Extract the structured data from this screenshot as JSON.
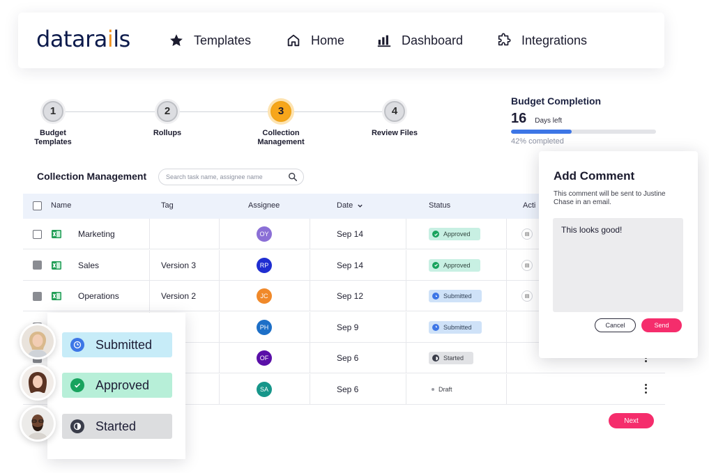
{
  "nav": {
    "logo": {
      "main": "datarails"
    },
    "items": [
      {
        "label": "Templates",
        "icon": "star-icon"
      },
      {
        "label": "Home",
        "icon": "home-icon"
      },
      {
        "label": "Dashboard",
        "icon": "bar-chart-icon"
      },
      {
        "label": "Integrations",
        "icon": "puzzle-icon"
      }
    ]
  },
  "stepper": {
    "steps": [
      {
        "number": "1",
        "label_line1": "Budget",
        "label_line2": "Templates",
        "active": false
      },
      {
        "number": "2",
        "label_line1": "Rollups",
        "label_line2": "",
        "active": false
      },
      {
        "number": "3",
        "label_line1": "Collection",
        "label_line2": "Management",
        "active": true
      },
      {
        "number": "4",
        "label_line1": "Review Files",
        "label_line2": "",
        "active": false
      }
    ]
  },
  "budget": {
    "title": "Budget Completion",
    "days": "16",
    "days_label": "Days left",
    "percent_label": "42% completed",
    "progress": 0.42,
    "progress_color": "#3d76e6"
  },
  "table": {
    "title": "Collection Management",
    "search_placeholder": "Search task name, assignee name",
    "columns": {
      "name": "Name",
      "tag": "Tag",
      "assignee": "Assignee",
      "date": "Date",
      "status": "Status",
      "actions": "Acti"
    },
    "rows": [
      {
        "name": "Marketing",
        "tag": "",
        "assignee": "OY",
        "avatar_color": "#8b6fd6",
        "date": "Sep 14",
        "status": "Approved"
      },
      {
        "name": "Sales",
        "tag": "Version 3",
        "assignee": "RP",
        "avatar_color": "#1f2ed1",
        "date": "Sep 14",
        "status": "Approved"
      },
      {
        "name": "Operations",
        "tag": "Version 2",
        "assignee": "JC",
        "avatar_color": "#f0892a",
        "date": "Sep 12",
        "status": "Submitted"
      },
      {
        "name": "",
        "tag": "n 1",
        "assignee": "PH",
        "avatar_color": "#1d6fc7",
        "date": "Sep 9",
        "status": "Submitted"
      },
      {
        "name": "",
        "tag": "",
        "assignee": "OF",
        "avatar_color": "#5a0fa8",
        "date": "Sep 6",
        "status": "Started"
      },
      {
        "name": "",
        "tag": "",
        "assignee": "SA",
        "avatar_color": "#17968a",
        "date": "Sep 6",
        "status": "Draft"
      }
    ],
    "next_label": "Next"
  },
  "modal": {
    "title": "Add Comment",
    "description": "This comment will be sent to Justine Chase in an email.",
    "comment_value": "This looks good!",
    "cancel_label": "Cancel",
    "send_label": "Send"
  },
  "legend": {
    "items": [
      {
        "label": "Submitted",
        "color": "#c7ecf8"
      },
      {
        "label": "Approved",
        "color": "#b7efd8"
      },
      {
        "label": "Started",
        "color": "#dcdddf"
      }
    ]
  },
  "colors": {
    "accent": "#f52d6c",
    "step_active": "#f7a61b",
    "excel": "#1f9d55"
  }
}
